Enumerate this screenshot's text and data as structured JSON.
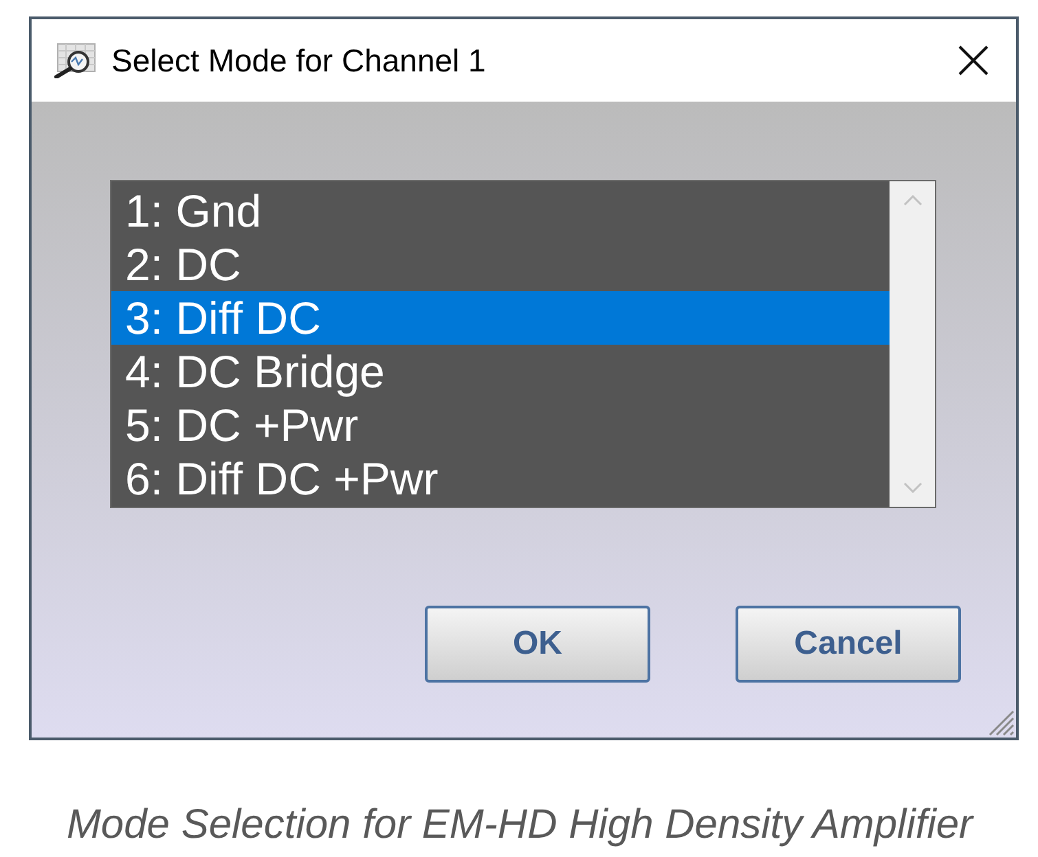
{
  "window": {
    "title": "Select Mode for Channel 1"
  },
  "modes": [
    {
      "label": "1: Gnd",
      "selected": false
    },
    {
      "label": "2: DC",
      "selected": false
    },
    {
      "label": "3: Diff DC",
      "selected": true
    },
    {
      "label": "4: DC Bridge",
      "selected": false
    },
    {
      "label": "5: DC +Pwr",
      "selected": false
    },
    {
      "label": "6: Diff DC +Pwr",
      "selected": false
    }
  ],
  "buttons": [
    {
      "label": "OK"
    },
    {
      "label": "Cancel"
    }
  ],
  "caption": "Mode Selection for EM-HD High Density Amplifier"
}
